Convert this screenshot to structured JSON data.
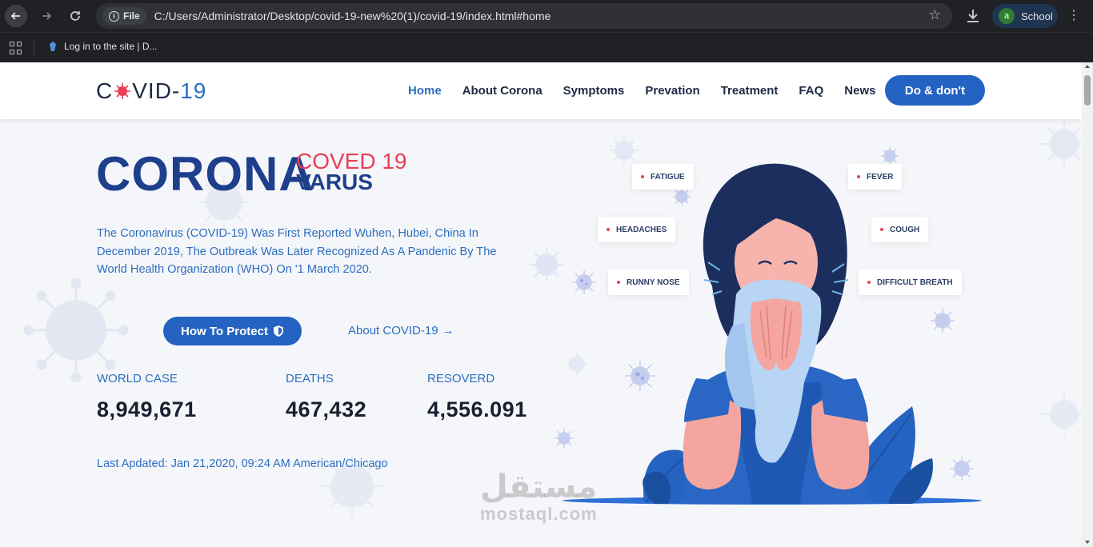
{
  "browser": {
    "url_chip": "File",
    "url": "C:/Users/Administrator/Desktop/covid-19-new%20(1)/covid-19/index.html#home",
    "profile_initial": "a",
    "profile_name": "School",
    "bookmark": "Log in to the site | D..."
  },
  "site": {
    "logo_prefix": "C",
    "logo_mid": "VID-",
    "logo_number": "19",
    "nav": [
      {
        "label": "Home",
        "active": true
      },
      {
        "label": "About Corona"
      },
      {
        "label": "Symptoms"
      },
      {
        "label": "Prevation"
      },
      {
        "label": "Treatment"
      },
      {
        "label": "FAQ"
      },
      {
        "label": "News"
      }
    ],
    "cta": "Do & don't"
  },
  "hero": {
    "title": "CORONA",
    "sup": "COVED 19",
    "sub": "VARUS",
    "description": "The Coronavirus (COVID-19) Was First Reported Wuhen, Hubei, China In December 2019, The Outbreak Was Later Recognized As A Pandenic By The World Health Organization (WHO) On '1 March 2020.",
    "protect_button": "How To Protect",
    "about_link": "About COVID-19",
    "arrow": "→",
    "stats": [
      {
        "label": "WORLD CASE",
        "value": "8,949,671"
      },
      {
        "label": "DEATHS",
        "value": "467,432"
      },
      {
        "label": "RESOVERD",
        "value": "4,556.091"
      }
    ],
    "updated": "Last Apdated: Jan 21,2020, 09:24 AM American/Chicago"
  },
  "symptoms": [
    "FATIGUE",
    "FEVER",
    "HEADACHES",
    "COUGH",
    "RUNNY NOSE",
    "DIFFICULT BREATH"
  ],
  "watermark": {
    "arabic": "مستقل",
    "latin": "mostaql.com"
  },
  "colors": {
    "primary": "#2563c2",
    "title": "#1e3f8c",
    "accent": "#e94057"
  }
}
